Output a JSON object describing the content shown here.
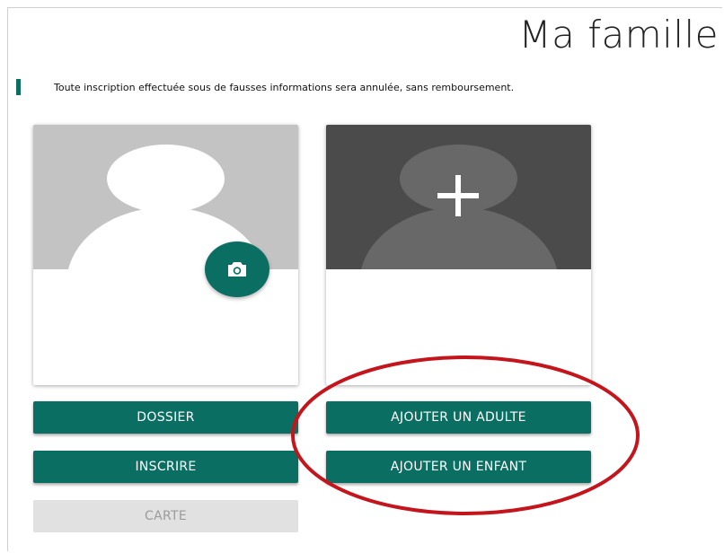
{
  "page": {
    "title": "Ma famille",
    "notice": "Toute inscription effectuée sous de fausses informations sera annulée, sans remboursement."
  },
  "members": [
    {
      "photo_icon": "person-silhouette-icon",
      "action_icon": "camera-icon"
    }
  ],
  "add_member": {
    "icon": "plus-icon"
  },
  "actions": {
    "dossier": "DOSSIER",
    "inscrire": "INSCRIRE",
    "carte": "CARTE",
    "ajouter_adulte": "AJOUTER UN ADULTE",
    "ajouter_enfant": "AJOUTER UN ENFANT"
  },
  "colors": {
    "accent": "#0b6e62",
    "disabled_bg": "#e1e1e1",
    "disabled_text": "#9b9b9b",
    "annotation": "#c4141c"
  }
}
